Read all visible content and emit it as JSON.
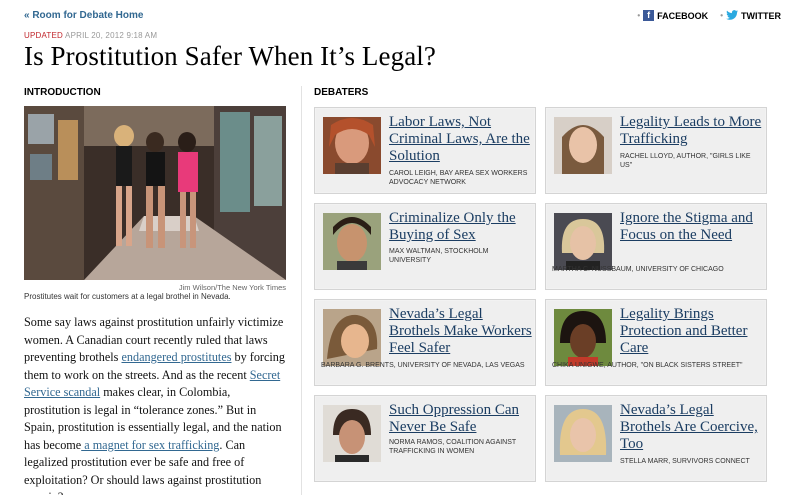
{
  "nav": {
    "back_link": "« Room for Debate Home"
  },
  "share": {
    "facebook": "FACEBOOK",
    "twitter": "TWITTER"
  },
  "dateline": {
    "updated": "UPDATED",
    "date": "APRIL 20, 2012 9:18 AM"
  },
  "headline": "Is Prostitution Safer When It’s Legal?",
  "introduction": {
    "label": "INTRODUCTION",
    "photo_credit": "Jim Wilson/The New York Times",
    "caption": "Prostitutes wait for customers at a legal brothel in Nevada.",
    "text_1": "Some say laws against prostitution unfairly victimize women. A Canadian court recently ruled that laws preventing brothels ",
    "link_1": "endangered prostitutes",
    "text_2": " by forcing them to work on the streets. And as the recent ",
    "link_2": "Secret Service scandal",
    "text_3": " makes clear, in Colombia, prostitution is legal in “tolerance zones.” But in Spain, prostitution is essentially legal, and the nation has become",
    "link_3": " a magnet for sex trafficking",
    "text_4": ". Can legalized prostitution ever be safe and free of exploitation? Or should laws against prostitution remain?"
  },
  "debaters": {
    "label": "DEBATERS",
    "cards": [
      {
        "title": "Labor Laws, Not Criminal Laws, Are the Solution",
        "author": "CAROL LEIGH, BAY AREA SEX WORKERS ADVOCACY NETWORK"
      },
      {
        "title": "Legality Leads to More Trafficking",
        "author": "RACHEL LLOYD, AUTHOR, \"GIRLS LIKE US\""
      },
      {
        "title": "Criminalize Only the Buying of Sex",
        "author": "MAX WALTMAN, STOCKHOLM UNIVERSITY"
      },
      {
        "title": "Ignore the Stigma and Focus on the Need",
        "author": "MARTHA C. NUSSBAUM, UNIVERSITY OF CHICAGO"
      },
      {
        "title": "Nevada’s Legal Brothels Make Workers Feel Safer",
        "author": "BARBARA G. BRENTS, UNIVERSITY OF NEVADA, LAS VEGAS"
      },
      {
        "title": "Legality Brings Protection and Better Care",
        "author": "CHIKA UNIGWE, AUTHOR, \"ON BLACK SISTERS STREET\""
      },
      {
        "title": "Such Oppression Can Never Be Safe",
        "author": "NORMA RAMOS, COALITION AGAINST TRAFFICKING IN WOMEN"
      },
      {
        "title": "Nevada’s Legal Brothels Are Coercive, Too",
        "author": "STELLA MARR, SURVIVORS CONNECT"
      }
    ]
  },
  "colors": {
    "link": "#326891",
    "headline_link": "#1b3d62",
    "updated": "#c1272d",
    "facebook": "#3b5998",
    "twitter": "#2aa9e0"
  }
}
